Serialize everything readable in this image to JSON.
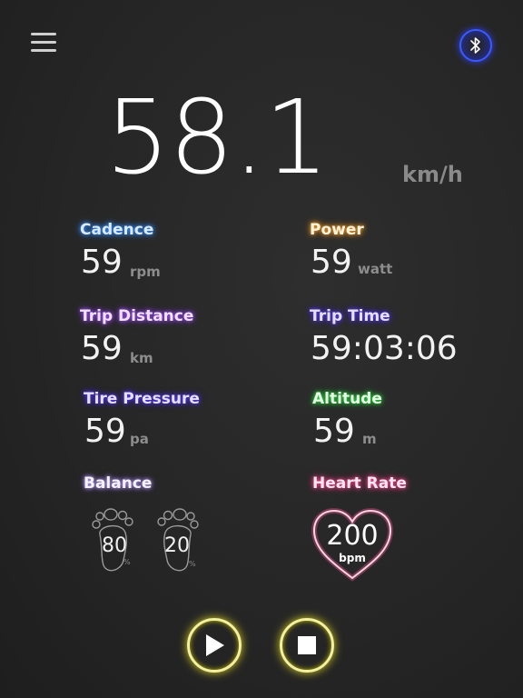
{
  "speed": {
    "value": "58.1",
    "unit": "km/h"
  },
  "metrics": {
    "cadence": {
      "label": "Cadence",
      "value": "59",
      "unit": "rpm"
    },
    "power": {
      "label": "Power",
      "value": "59",
      "unit": "watt"
    },
    "trip_distance": {
      "label": "Trip Distance",
      "value": "59",
      "unit": "km"
    },
    "trip_time": {
      "label": "Trip Time",
      "value": "59:03:06"
    },
    "tire_pressure": {
      "label": "Tire Pressure",
      "value": "59",
      "unit": "pa"
    },
    "altitude": {
      "label": "Altitude",
      "value": "59",
      "unit": "m"
    }
  },
  "balance": {
    "label": "Balance",
    "left": {
      "value": "80",
      "unit": "%"
    },
    "right": {
      "value": "20",
      "unit": "%"
    }
  },
  "heart_rate": {
    "label": "Heart Rate",
    "value": "200",
    "unit": "bpm"
  },
  "icons": {
    "menu": "hamburger-menu-icon",
    "bluetooth": "bluetooth-icon",
    "play": "play-icon",
    "stop": "stop-icon"
  },
  "colors": {
    "cadence": "#2f8cff",
    "power": "#f0a030",
    "trip_distance": "#a050ff",
    "trip_time": "#5a3cff",
    "tire_pressure": "#5a3cff",
    "altitude": "#30e040",
    "heart_rate": "#ff4a90",
    "controls": "#f3f0a0",
    "bluetooth": "#3b5bff"
  }
}
